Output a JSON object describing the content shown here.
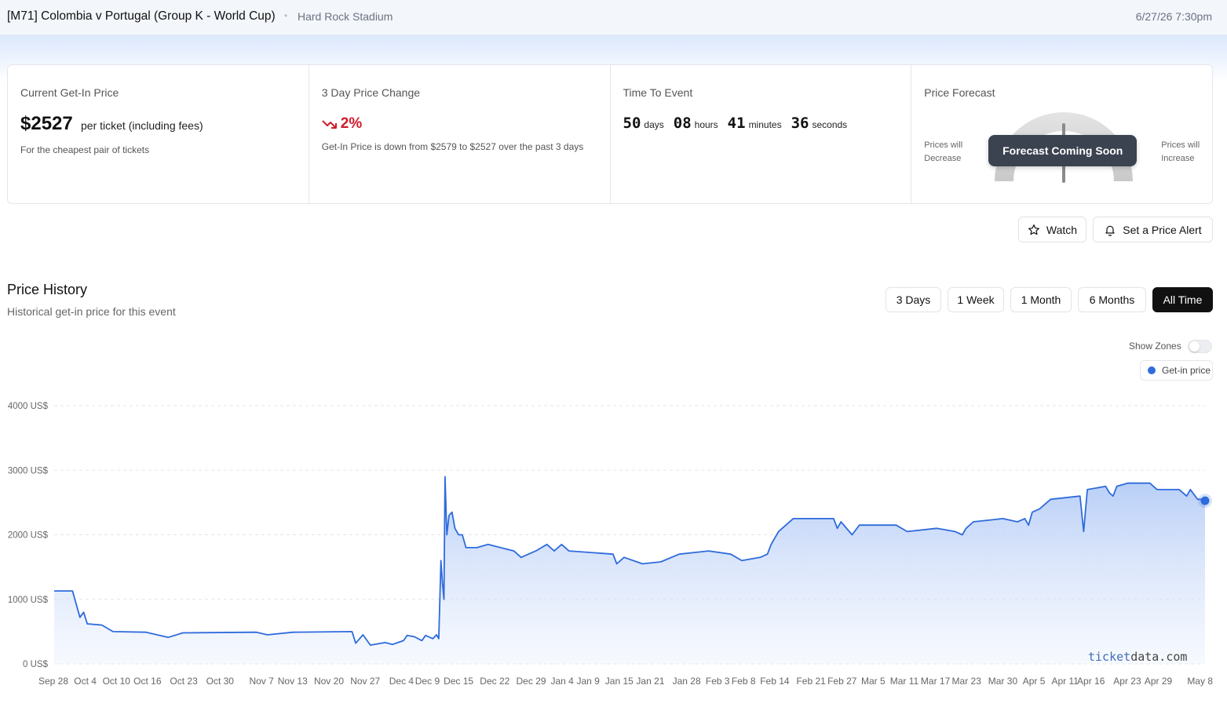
{
  "header": {
    "title": "[M71] Colombia v Portugal (Group K - World Cup)",
    "separator": "•",
    "venue": "Hard Rock Stadium",
    "datetime": "6/27/26 7:30pm"
  },
  "cards": {
    "current": {
      "label": "Current Get-In Price",
      "price": "$2527",
      "per_ticket": "per ticket (including fees)",
      "sub": "For the cheapest pair of tickets"
    },
    "change": {
      "label": "3 Day Price Change",
      "icon": "trend-down-icon",
      "value": "2%",
      "color": "#d11a2a",
      "sub": "Get-In Price is down from $2579 to $2527 over the past 3 days"
    },
    "time": {
      "label": "Time To Event",
      "days": "50",
      "days_label": "days",
      "hours": "08",
      "hours_label": "hours",
      "minutes": "41",
      "minutes_label": "minutes",
      "seconds": "36",
      "seconds_label": "seconds"
    },
    "forecast": {
      "label": "Price Forecast",
      "left_line1": "Prices will",
      "left_line2": "Decrease",
      "right_line1": "Prices will",
      "right_line2": "Increase",
      "badge": "Forecast Coming Soon"
    }
  },
  "actions": {
    "watch": {
      "label": "Watch",
      "icon": "star-icon"
    },
    "alert": {
      "label": "Set a Price Alert",
      "icon": "bell-icon"
    }
  },
  "history": {
    "title": "Price History",
    "subtitle": "Historical get-in price for this event",
    "ranges": [
      "3 Days",
      "1 Week",
      "1 Month",
      "6 Months",
      "All Time"
    ],
    "active_range": "All Time",
    "show_zones_label": "Show Zones",
    "show_zones": false
  },
  "chart_data": {
    "type": "area",
    "series": [
      {
        "name": "Get-in price",
        "color": "#2f6bdc",
        "points": [
          [
            0,
            1130
          ],
          [
            5,
            1130
          ],
          [
            7,
            720
          ],
          [
            8,
            800
          ],
          [
            9,
            620
          ],
          [
            13,
            600
          ],
          [
            16,
            500
          ],
          [
            25,
            490
          ],
          [
            31,
            410
          ],
          [
            35,
            480
          ],
          [
            55,
            490
          ],
          [
            58,
            450
          ],
          [
            65,
            490
          ],
          [
            81,
            500
          ],
          [
            82,
            320
          ],
          [
            84,
            450
          ],
          [
            86,
            290
          ],
          [
            90,
            330
          ],
          [
            92,
            300
          ],
          [
            95,
            360
          ],
          [
            96,
            440
          ],
          [
            98,
            420
          ],
          [
            100,
            360
          ],
          [
            101,
            440
          ],
          [
            103,
            390
          ],
          [
            104,
            450
          ],
          [
            104.6,
            390
          ],
          [
            105.2,
            1600
          ],
          [
            105.6,
            1250
          ],
          [
            106,
            1000
          ],
          [
            106.3,
            2900
          ],
          [
            106.8,
            2000
          ],
          [
            107.4,
            2300
          ],
          [
            108.2,
            2350
          ],
          [
            109,
            2100
          ],
          [
            110,
            2000
          ],
          [
            111,
            2000
          ],
          [
            112,
            1800
          ],
          [
            115,
            1800
          ],
          [
            118,
            1850
          ],
          [
            125,
            1750
          ],
          [
            127,
            1650
          ],
          [
            131,
            1750
          ],
          [
            134,
            1850
          ],
          [
            136,
            1750
          ],
          [
            138,
            1850
          ],
          [
            140,
            1750
          ],
          [
            152,
            1700
          ],
          [
            153,
            1550
          ],
          [
            155,
            1650
          ],
          [
            160,
            1550
          ],
          [
            165,
            1580
          ],
          [
            170,
            1700
          ],
          [
            178,
            1750
          ],
          [
            184,
            1700
          ],
          [
            187,
            1600
          ],
          [
            192,
            1650
          ],
          [
            194,
            1700
          ],
          [
            195,
            1850
          ],
          [
            197,
            2050
          ],
          [
            201,
            2250
          ],
          [
            212,
            2250
          ],
          [
            213,
            2100
          ],
          [
            214,
            2200
          ],
          [
            217,
            2000
          ],
          [
            219,
            2150
          ],
          [
            229,
            2150
          ],
          [
            232,
            2050
          ],
          [
            240,
            2100
          ],
          [
            245,
            2050
          ],
          [
            247,
            2000
          ],
          [
            248,
            2100
          ],
          [
            250,
            2200
          ],
          [
            258,
            2250
          ],
          [
            262,
            2200
          ],
          [
            264,
            2250
          ],
          [
            265,
            2150
          ],
          [
            266,
            2350
          ],
          [
            268,
            2400
          ],
          [
            271,
            2550
          ],
          [
            279,
            2600
          ],
          [
            280,
            2050
          ],
          [
            281,
            2700
          ],
          [
            286,
            2750
          ],
          [
            287,
            2650
          ],
          [
            288,
            2600
          ],
          [
            289,
            2750
          ],
          [
            292,
            2800
          ],
          [
            298,
            2800
          ],
          [
            300,
            2700
          ],
          [
            306,
            2700
          ],
          [
            308,
            2600
          ],
          [
            309,
            2700
          ],
          [
            311,
            2550
          ],
          [
            312,
            2550
          ],
          [
            313,
            2527
          ]
        ]
      }
    ],
    "x_ticks": [
      "Sep 28",
      "Oct 4",
      "Oct 10",
      "Oct 16",
      "Oct 23",
      "Oct 30",
      "Nov 7",
      "Nov 13",
      "Nov 20",
      "Nov 27",
      "Dec 4",
      "Dec 9",
      "Dec 15",
      "Dec 22",
      "Dec 29",
      "Jan 4",
      "Jan 9",
      "Jan 15",
      "Jan 21",
      "Jan 28",
      "Feb 3",
      "Feb 8",
      "Feb 14",
      "Feb 21",
      "Feb 27",
      "Mar 5",
      "Mar 11",
      "Mar 17",
      "Mar 23",
      "Mar 30",
      "Apr 5",
      "Apr 11",
      "Apr 16",
      "Apr 23",
      "Apr 29",
      "May 8"
    ],
    "x_tick_days": [
      0,
      6,
      12,
      18,
      25,
      32,
      40,
      46,
      53,
      60,
      67,
      72,
      78,
      85,
      92,
      98,
      103,
      109,
      115,
      122,
      128,
      133,
      139,
      146,
      152,
      158,
      164,
      170,
      176,
      183,
      189,
      195,
      200,
      207,
      213,
      222
    ],
    "y_ticks": [
      0,
      1000,
      2000,
      3000,
      4000
    ],
    "y_tick_labels": [
      "0 US$",
      "1000 US$",
      "2000 US$",
      "3000 US$",
      "4000 US$"
    ],
    "ylim": [
      0,
      4000
    ],
    "grid": true,
    "legend": "top-right"
  },
  "watermark": {
    "part1": "ticket",
    "part2": "data.com"
  }
}
